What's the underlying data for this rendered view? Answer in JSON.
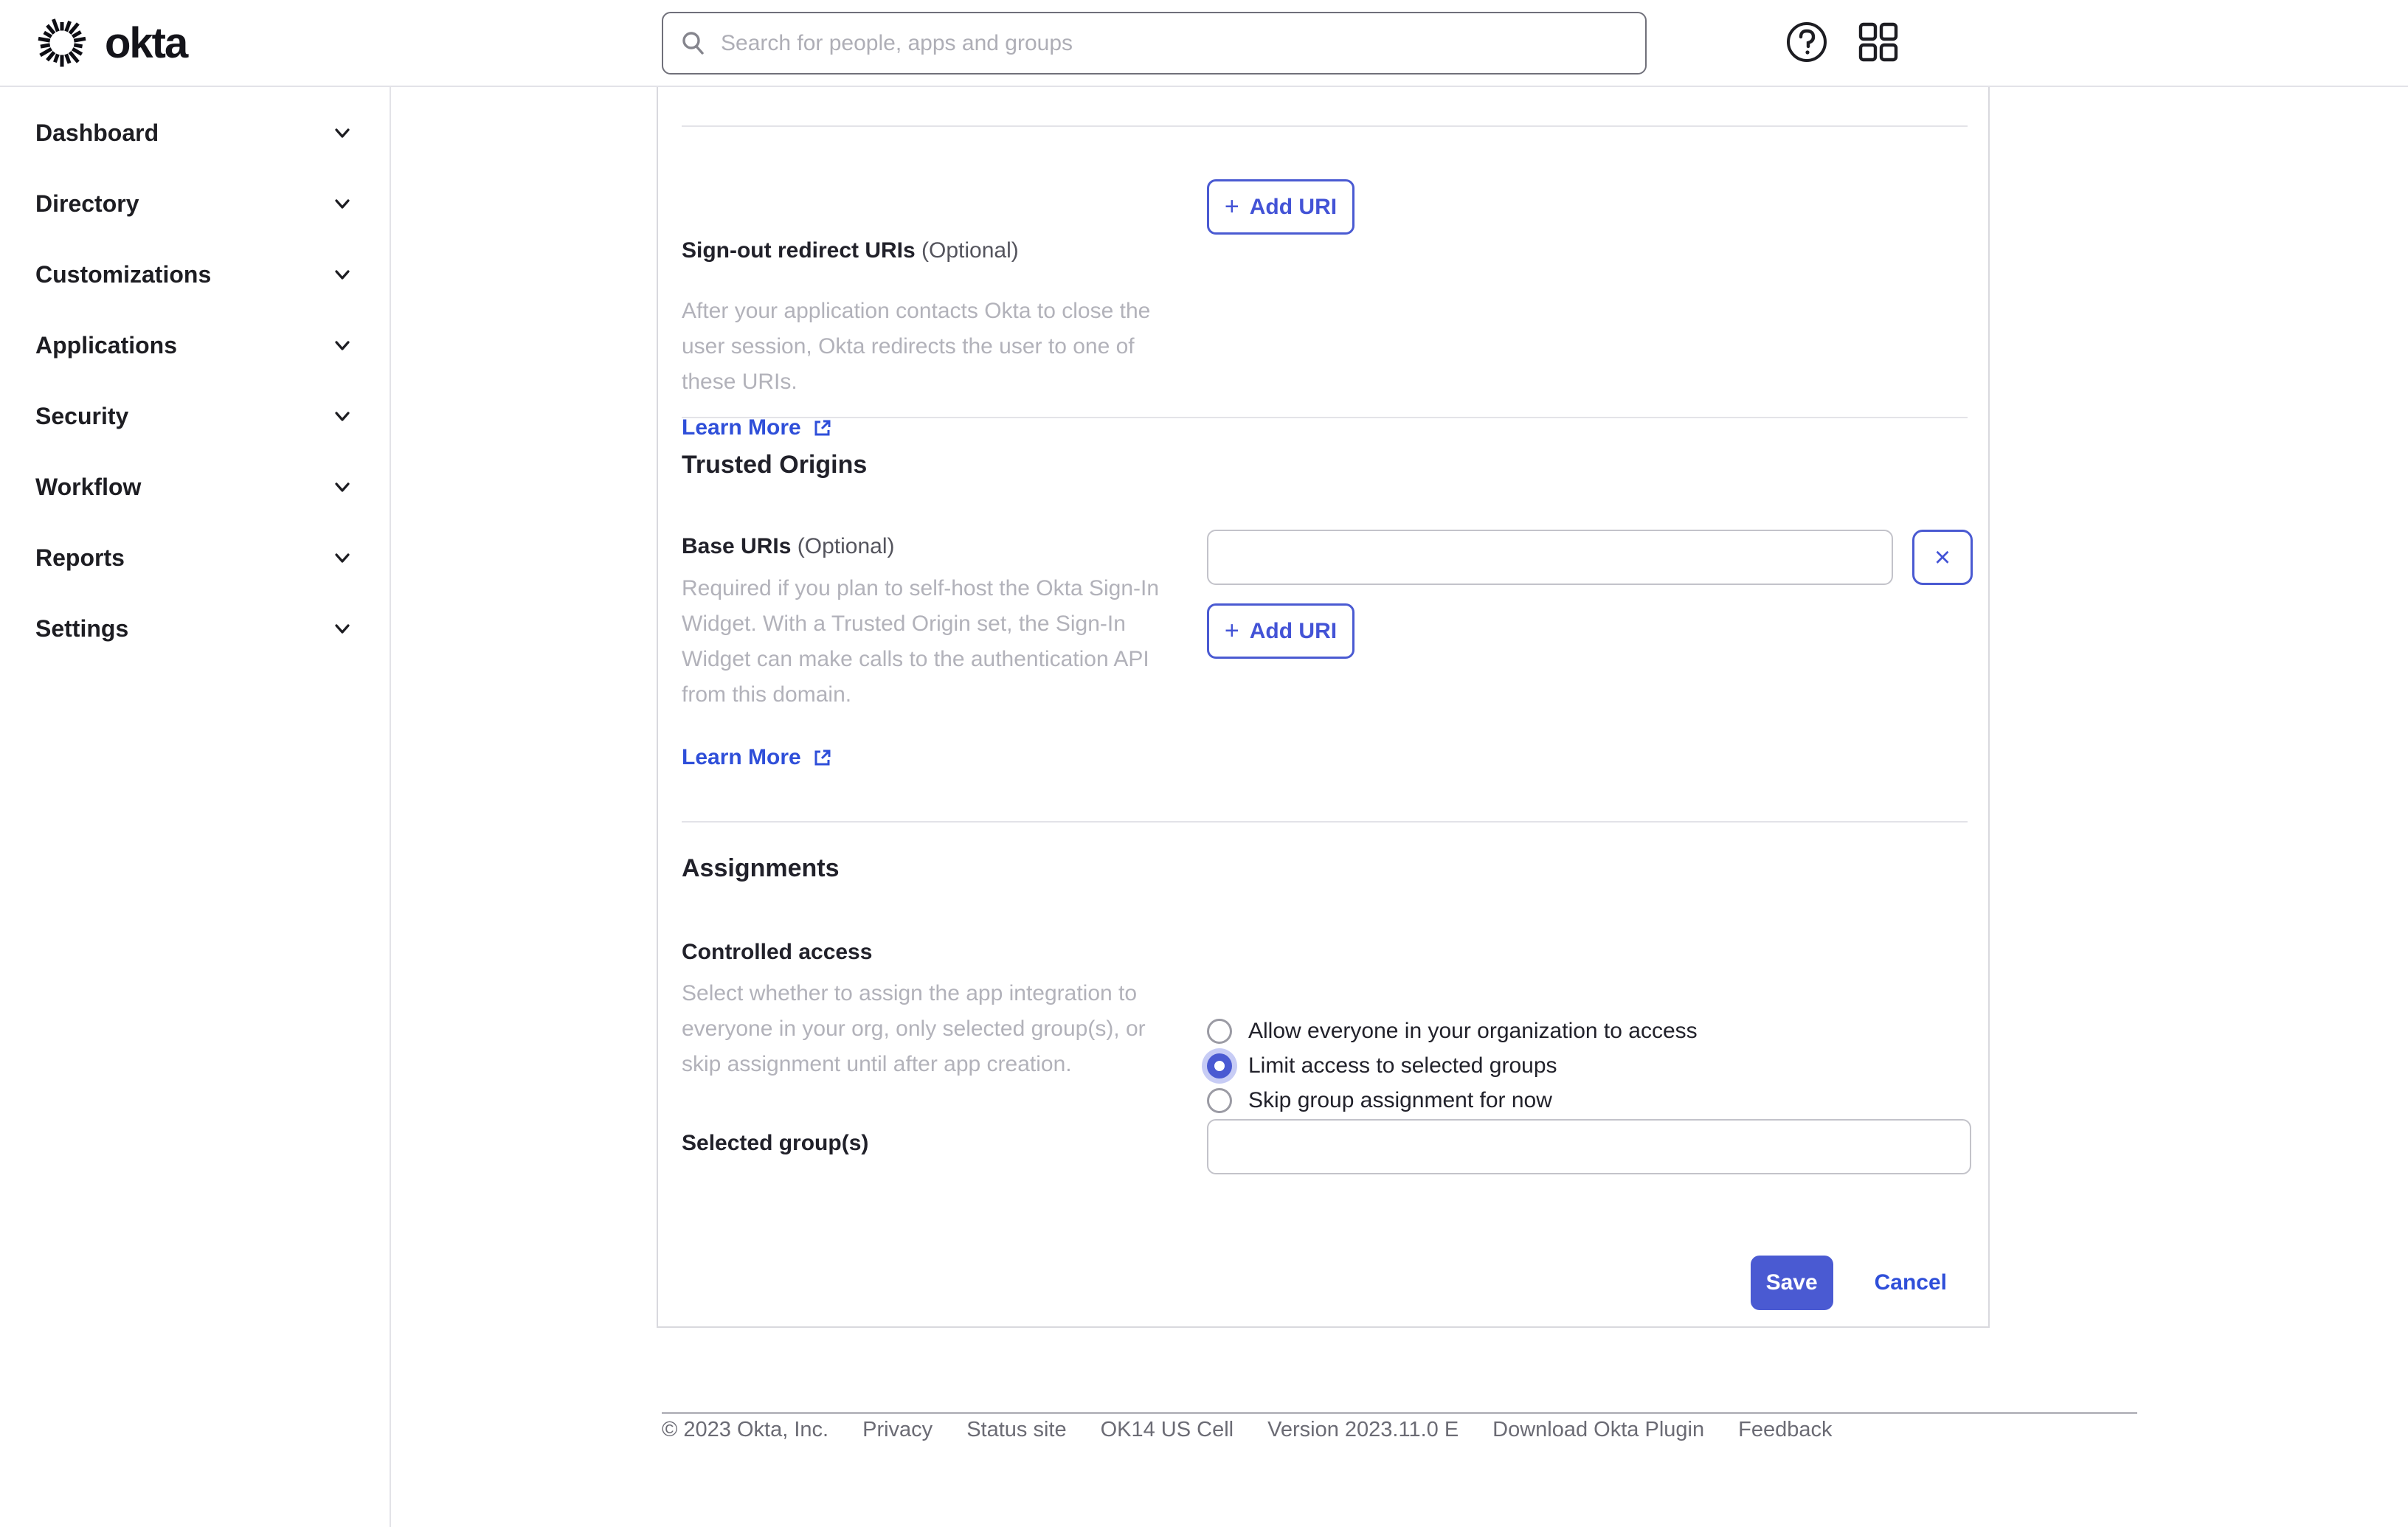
{
  "brand": {
    "logo_text": "okta"
  },
  "header": {
    "search_placeholder": "Search for people, apps and groups",
    "icons": [
      "help-icon",
      "apps-grid-icon"
    ]
  },
  "sidebar": {
    "items": [
      {
        "label": "Dashboard"
      },
      {
        "label": "Directory"
      },
      {
        "label": "Customizations"
      },
      {
        "label": "Applications"
      },
      {
        "label": "Security"
      },
      {
        "label": "Workflow"
      },
      {
        "label": "Reports"
      },
      {
        "label": "Settings"
      }
    ]
  },
  "colors": {
    "accent_blue": "#4a5ad2",
    "link_blue": "#2f4fd9",
    "text_dark": "#1d1d22",
    "text_muted": "#b2b2ba"
  },
  "sections": {
    "signout": {
      "label": "Sign-out redirect URIs",
      "optional": "(Optional)",
      "description": "After your application contacts Okta to close the user session, Okta redirects the user to one of these URIs.",
      "learn_more": "Learn More",
      "add_uri_plus": "+",
      "add_uri": "Add URI"
    },
    "trusted": {
      "heading": "Trusted Origins",
      "label": "Base URIs",
      "optional": "(Optional)",
      "description": "Required if you plan to self-host the Okta Sign-In Widget. With a Trusted Origin set, the Sign-In Widget can make calls to the authentication API from this domain.",
      "learn_more": "Learn More",
      "base_uri_value": "",
      "remove_glyph": "×",
      "add_uri_plus": "+",
      "add_uri": "Add URI"
    },
    "assignments": {
      "heading": "Assignments",
      "label": "Controlled access",
      "description": "Select whether to assign the app integration to everyone in your org, only selected group(s), or skip assignment until after app creation.",
      "options": [
        {
          "label": "Allow everyone in your organization to access",
          "selected": false
        },
        {
          "label": "Limit access to selected groups",
          "selected": true
        },
        {
          "label": "Skip group assignment for now",
          "selected": false
        }
      ],
      "selected_groups_label": "Selected group(s)",
      "selected_groups_value": ""
    },
    "actions": {
      "save": "Save",
      "cancel": "Cancel"
    }
  },
  "footer": {
    "items": [
      "© 2023 Okta, Inc.",
      "Privacy",
      "Status site",
      "OK14 US Cell",
      "Version 2023.11.0 E",
      "Download Okta Plugin",
      "Feedback"
    ]
  }
}
